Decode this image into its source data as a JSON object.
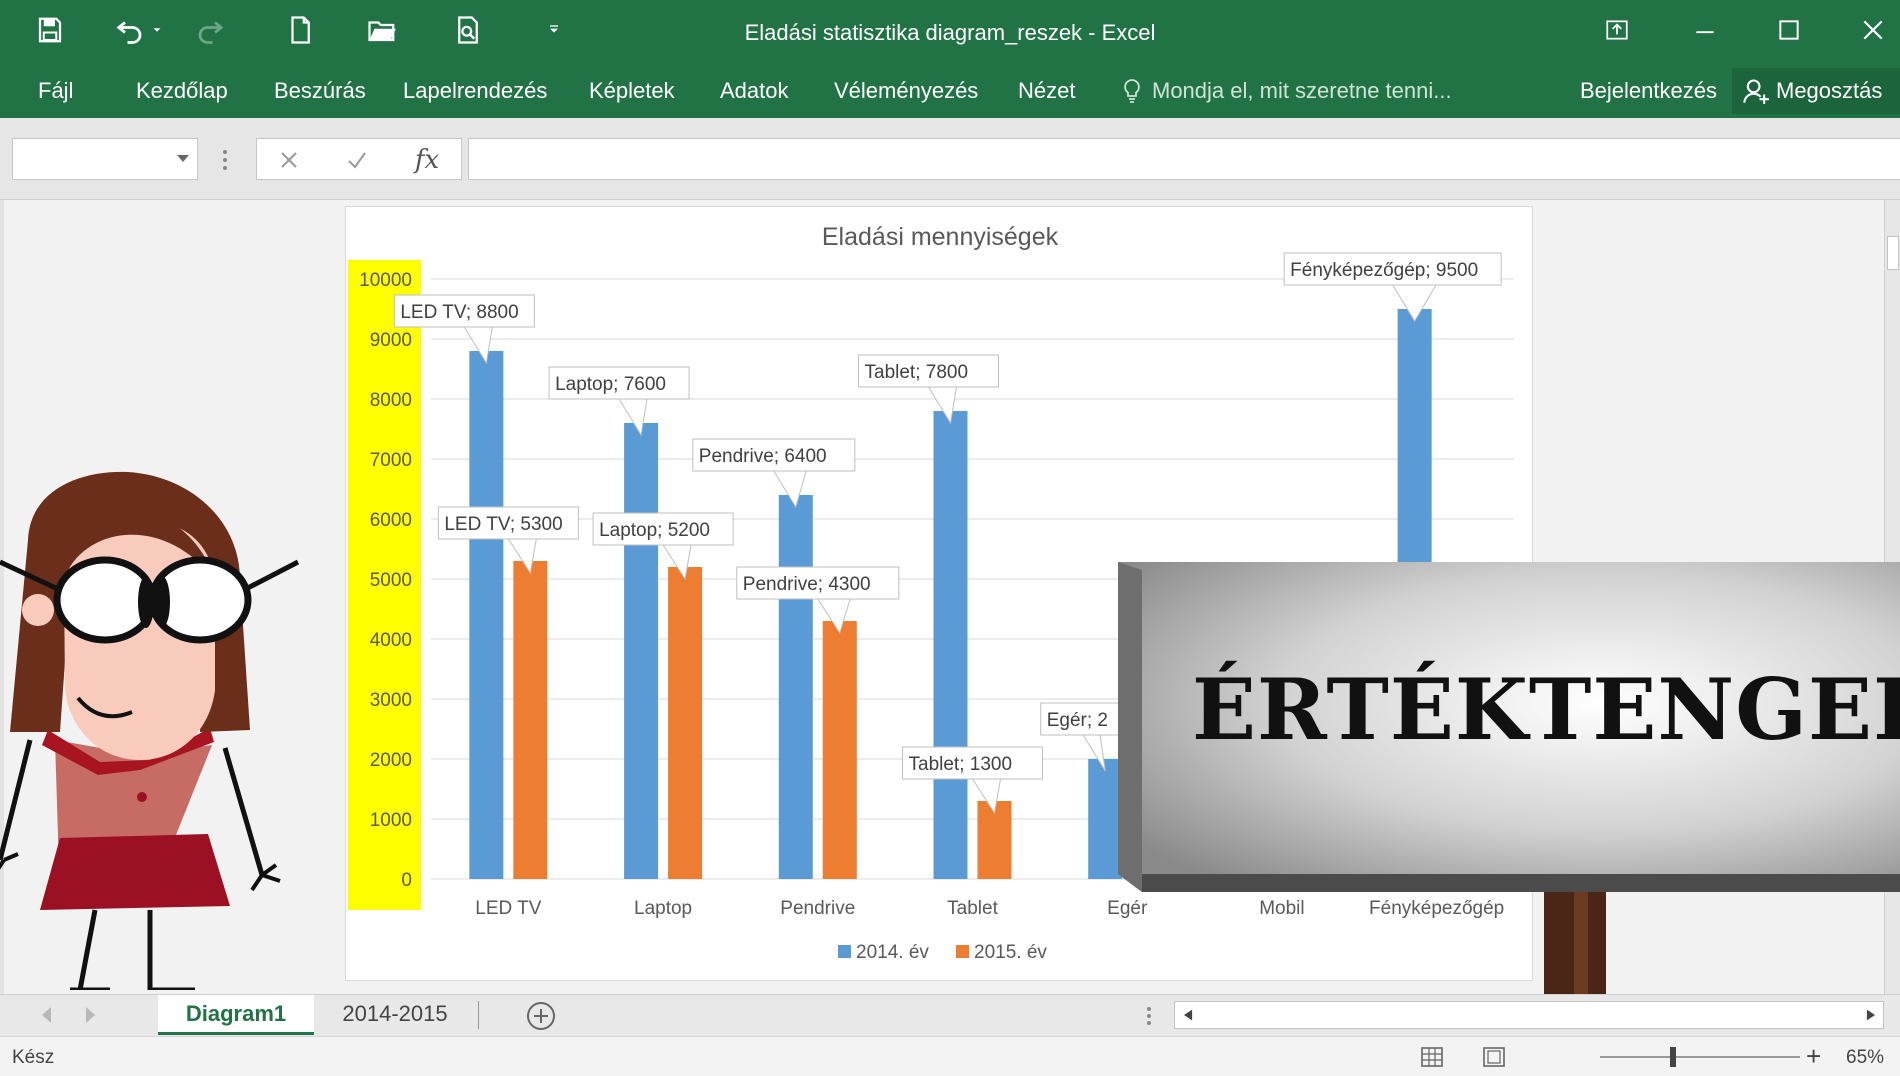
{
  "window": {
    "title": "Eladási statisztika diagram_reszek - Excel",
    "accent": "#217346"
  },
  "ribbon": {
    "tabs": [
      "Fájl",
      "Kezdőlap",
      "Beszúrás",
      "Lapelrendezés",
      "Képletek",
      "Adatok",
      "Véleményezés",
      "Nézet"
    ],
    "tell_me": "Mondja el, mit szeretne tenni...",
    "signin": "Bejelentkezés",
    "share": "Megosztás"
  },
  "formula_bar": {
    "fx": "fx",
    "name_box": "",
    "formula": ""
  },
  "chart_data": {
    "type": "bar",
    "title": "Eladási mennyiségek",
    "categories": [
      "LED TV",
      "Laptop",
      "Pendrive",
      "Tablet",
      "Egér",
      "Mobil",
      "Fényképezőgép"
    ],
    "series": [
      {
        "name": "2014. év",
        "color": "#5b9bd5",
        "values": [
          8800,
          7600,
          6400,
          7800,
          2000,
          null,
          9500
        ]
      },
      {
        "name": "2015. év",
        "color": "#ed7d31",
        "values": [
          5300,
          5200,
          4300,
          1300,
          null,
          null,
          null
        ]
      }
    ],
    "y_ticks": [
      "10000",
      "9000",
      "8000",
      "7000",
      "6000",
      "5000",
      "4000",
      "3000",
      "2000",
      "1000",
      "0"
    ],
    "ylim": [
      0,
      10000
    ],
    "grid": true,
    "legend": "bottom",
    "axis_highlight": "#ffff00",
    "data_labels": [
      {
        "series": 0,
        "index": 0,
        "text": "LED TV; 8800"
      },
      {
        "series": 0,
        "index": 1,
        "text": "Laptop; 7600"
      },
      {
        "series": 0,
        "index": 2,
        "text": "Pendrive; 6400"
      },
      {
        "series": 0,
        "index": 3,
        "text": "Tablet; 7800"
      },
      {
        "series": 0,
        "index": 4,
        "text": "Egér; 2"
      },
      {
        "series": 0,
        "index": 6,
        "text": "Fényképezőgép; 9500"
      },
      {
        "series": 1,
        "index": 0,
        "text": "LED TV; 5300"
      },
      {
        "series": 1,
        "index": 1,
        "text": "Laptop; 5200"
      },
      {
        "series": 1,
        "index": 2,
        "text": "Pendrive; 4300"
      },
      {
        "series": 1,
        "index": 3,
        "text": "Tablet; 1300"
      },
      {
        "series": 1,
        "index": 4,
        "text": "Eg"
      }
    ]
  },
  "overlay": {
    "sign_text": "ÉRTÉKTENGELY"
  },
  "sheet_tabs": [
    "Diagram1",
    "2014-2015"
  ],
  "status": {
    "text": "Kész",
    "zoom": "65%"
  }
}
